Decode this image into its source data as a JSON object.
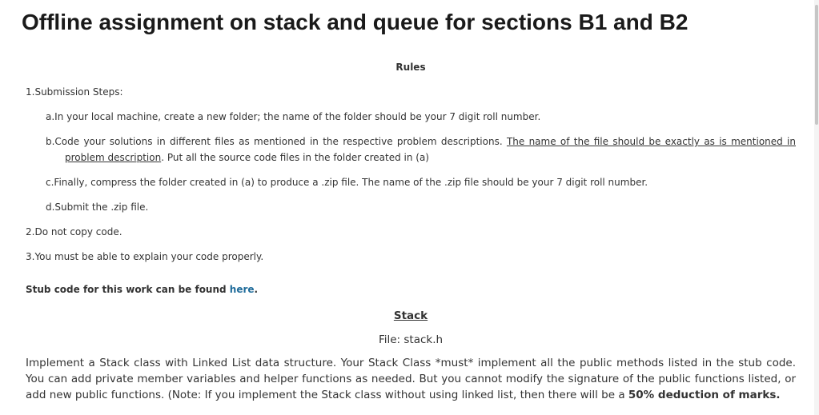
{
  "page": {
    "title": "Offline assignment on stack and queue for sections B1 and B2"
  },
  "rules": {
    "heading": "Rules",
    "item1": "1.Submission Steps:",
    "item1a": "a.In your local machine, create a new folder; the name of the folder should be your 7 digit roll number.",
    "item1b_pre": "b.Code your solutions in different files as mentioned in the respective problem descriptions. ",
    "item1b_underlined": "The name of the file should be exactly as is mentioned in problem description",
    "item1b_post": ". Put all the source code files in the folder created in (a)",
    "item1c": "c.Finally, compress the folder created in (a) to produce a .zip file. The name of the .zip file should be your 7 digit roll number.",
    "item1d": "d.Submit the .zip file.",
    "item2": "2.Do not copy code.",
    "item3": "3.You must be able to explain your code properly."
  },
  "stub": {
    "text": "Stub code for this work can be found ",
    "link_label": "here",
    "suffix": "."
  },
  "stack_section": {
    "title": "Stack",
    "file": "File: stack.h",
    "paragraph": "Implement a Stack class with Linked List data structure. Your Stack Class *must* implement all the public methods listed in the stub code. You can add private member variables and helper functions as needed. But you cannot modify the signature of the public functions listed, or add new public functions. (Note: If you implement the Stack class without using linked list, then there will be a ",
    "bold_note": "50% deduction of marks."
  },
  "colors": {
    "link": "#1e6b9a",
    "text": "#333333",
    "title": "#1a1a1a"
  }
}
